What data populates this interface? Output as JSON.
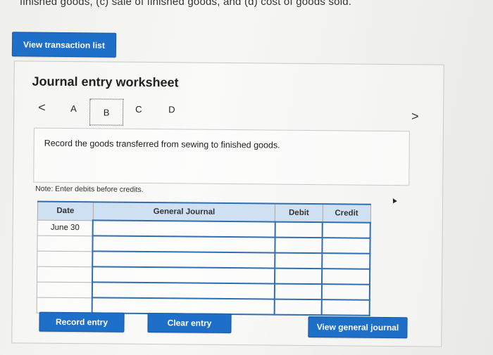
{
  "header": {
    "cut_text": "finished goods, (c) sale of finished goods, and (d) cost of goods sold."
  },
  "buttons": {
    "view_transaction_list": "View transaction list",
    "record_entry": "Record entry",
    "clear_entry": "Clear entry",
    "view_general_journal": "View general journal"
  },
  "worksheet": {
    "title": "Journal entry worksheet",
    "nav_prev": "<",
    "nav_next": ">",
    "tabs": [
      "A",
      "B",
      "C",
      "D"
    ],
    "active_tab": "B",
    "instruction": "Record the goods transferred from sewing to finished goods.",
    "note": "Note: Enter debits before credits."
  },
  "journal": {
    "headers": {
      "date": "Date",
      "general_journal": "General Journal",
      "debit": "Debit",
      "credit": "Credit"
    },
    "rows": [
      {
        "date": "June 30",
        "account": "",
        "debit": "",
        "credit": ""
      },
      {
        "date": "",
        "account": "",
        "debit": "",
        "credit": ""
      },
      {
        "date": "",
        "account": "",
        "debit": "",
        "credit": ""
      },
      {
        "date": "",
        "account": "",
        "debit": "",
        "credit": ""
      },
      {
        "date": "",
        "account": "",
        "debit": "",
        "credit": ""
      },
      {
        "date": "",
        "account": "",
        "debit": "",
        "credit": ""
      }
    ]
  },
  "colors": {
    "button_blue": "#1e6fc8",
    "header_bg": "#cfe0f2",
    "border_blue": "#2f6fb0"
  }
}
